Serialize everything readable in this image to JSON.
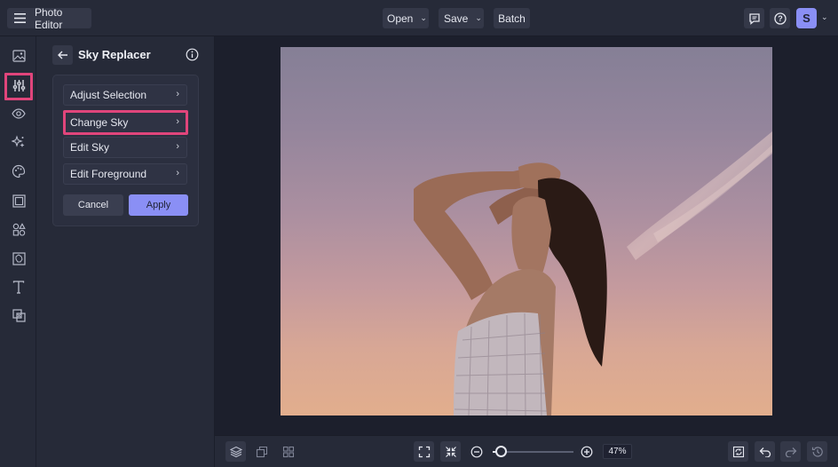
{
  "app": {
    "title": "Photo Editor",
    "user_initial": "S"
  },
  "toolbar": {
    "open_label": "Open",
    "save_label": "Save",
    "batch_label": "Batch"
  },
  "left_rail": {
    "tools": [
      "image-icon",
      "adjust-sliders-icon",
      "eye-icon",
      "sparkle-icon",
      "palette-icon",
      "frame-icon",
      "shapes-icon",
      "texture-icon",
      "text-icon",
      "overlay-icon"
    ],
    "active_tool": "adjust-sliders-icon"
  },
  "panel": {
    "title": "Sky Replacer",
    "items": [
      {
        "label": "Adjust Selection"
      },
      {
        "label": "Change Sky"
      },
      {
        "label": "Edit Sky"
      },
      {
        "label": "Edit Foreground"
      }
    ],
    "highlighted_item": "Change Sky",
    "cancel_label": "Cancel",
    "apply_label": "Apply"
  },
  "bottom": {
    "zoom": "47%",
    "zoom_fraction": 0.1
  },
  "colors": {
    "accent": "#8a8ff5",
    "highlight": "#e0457b",
    "bg": "#1c1f2c",
    "panel": "#262a38"
  }
}
